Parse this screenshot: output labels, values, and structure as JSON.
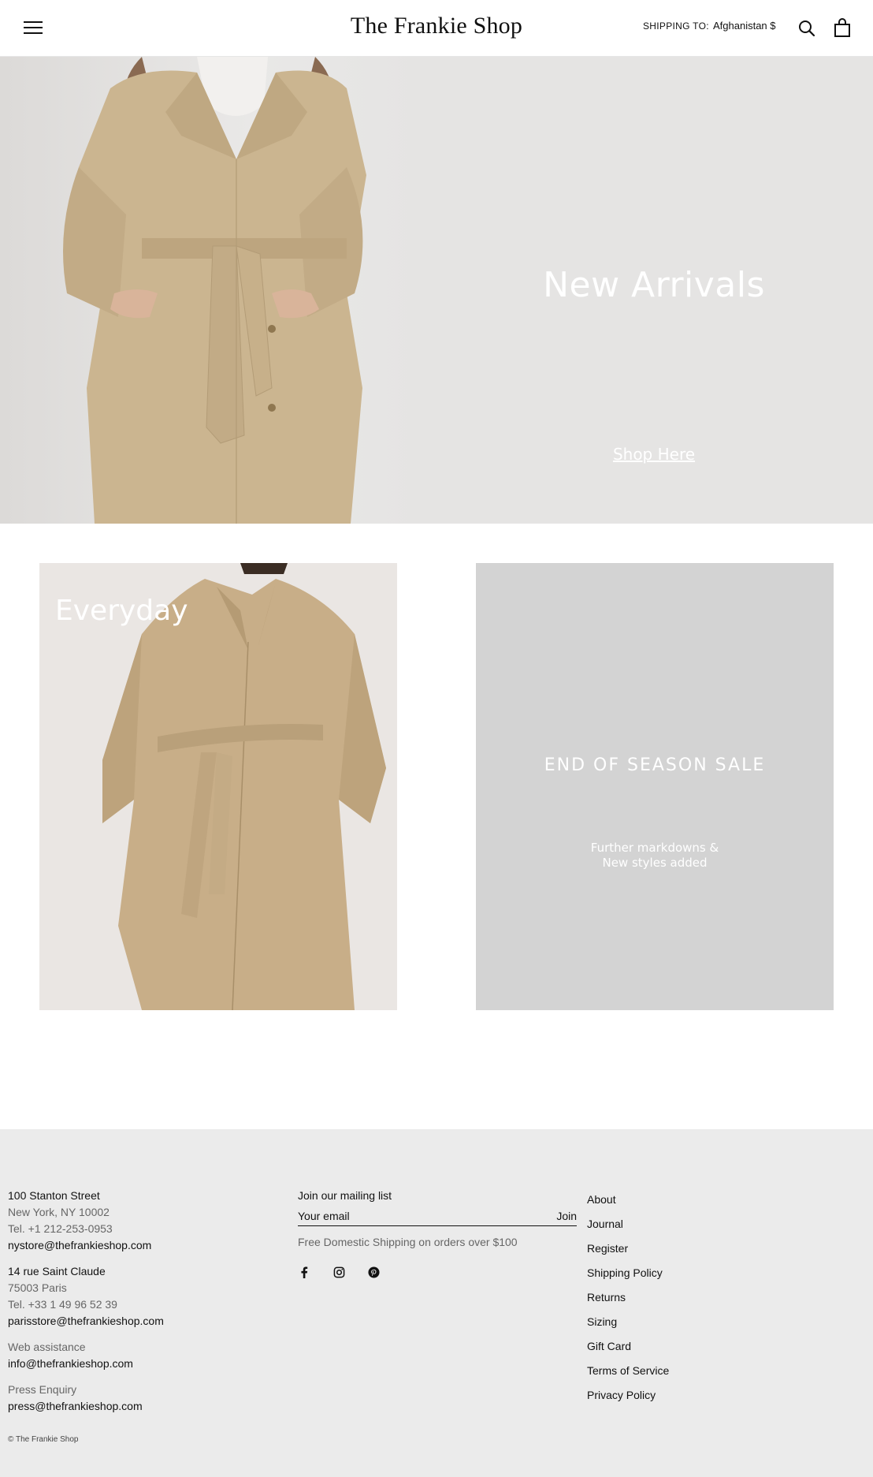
{
  "header": {
    "brand": "The Frankie Shop",
    "shipping_label": "SHIPPING TO:",
    "shipping_value": "Afghanistan $"
  },
  "hero": {
    "title": "New Arrivals",
    "link": "Shop Here"
  },
  "tiles": {
    "everyday_title": "Everyday",
    "sale_title": "END OF SEASON SALE",
    "sale_line1": "Further markdowns &",
    "sale_line2": "New styles added"
  },
  "footer": {
    "ny": {
      "street": "100 Stanton Street",
      "city": "New York, NY 10002",
      "tel": "Tel. +1 212-253-0953",
      "email": "nystore@thefrankieshop.com"
    },
    "paris": {
      "street": "14 rue Saint Claude",
      "city": "75003 Paris",
      "tel": "Tel. +33 1 49 96 52 39",
      "email": "parisstore@thefrankieshop.com"
    },
    "web": {
      "label": "Web assistance",
      "email": "info@thefrankieshop.com"
    },
    "press": {
      "label": "Press Enquiry",
      "email": "press@thefrankieshop.com"
    },
    "mailing": {
      "title": "Join our mailing list",
      "placeholder": "Your email",
      "join": "Join",
      "note": "Free Domestic Shipping on orders over $100"
    },
    "nav": [
      "About",
      "Journal",
      "Register",
      "Shipping Policy",
      "Returns",
      "Sizing",
      "Gift Card",
      "Terms of Service",
      "Privacy Policy"
    ],
    "copyright": "© The Frankie Shop"
  },
  "icons": {
    "menu": "hamburger-menu-icon",
    "search": "search-icon",
    "cart": "shopping-bag-icon",
    "facebook": "facebook-icon",
    "instagram": "instagram-icon",
    "pinterest": "pinterest-icon"
  },
  "colors": {
    "hero_bg": "#e5e4e3",
    "sale_bg": "#d3d3d3",
    "footer_bg": "#ebebeb",
    "coat": "#c9b48f"
  }
}
